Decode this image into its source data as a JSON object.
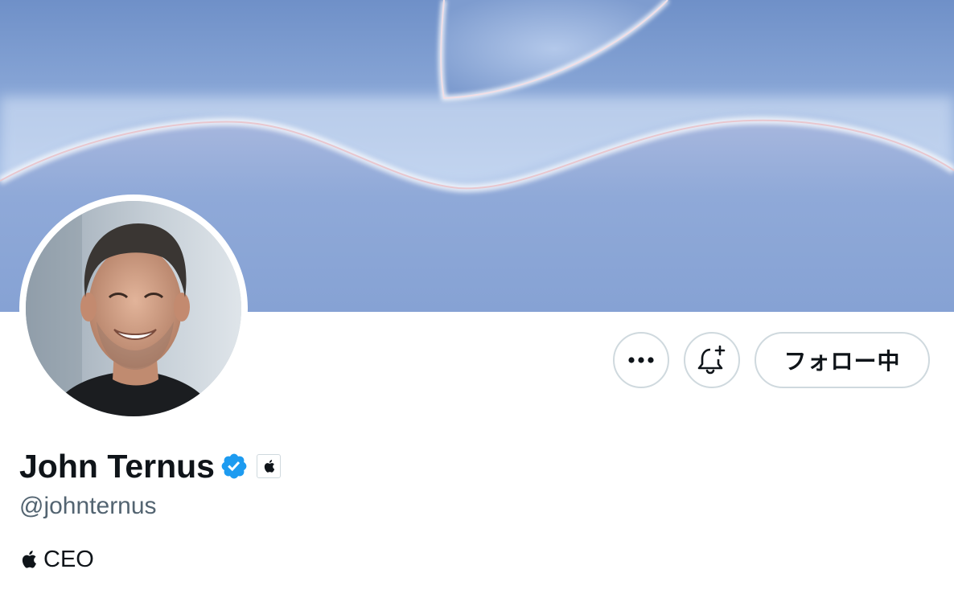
{
  "profile": {
    "display_name": "John Ternus",
    "handle": "@johnternus",
    "bio": {
      "icon": "apple-logo-icon",
      "text": "CEO"
    },
    "verified_badge": "verified-badge-icon",
    "affiliate_badge": "apple-affiliate-icon"
  },
  "actions": {
    "more_icon": "more-horizontal-icon",
    "notify_icon": "bell-plus-icon",
    "following_label": "フォロー中"
  },
  "colors": {
    "verified_blue": "#1d9bf0",
    "text_primary": "#0f1419",
    "text_secondary": "#536471",
    "button_border": "#cfd9de"
  }
}
